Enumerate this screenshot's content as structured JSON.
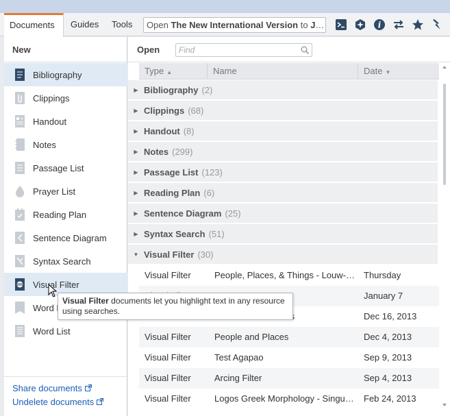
{
  "toolbar": {
    "tabs": [
      "Documents",
      "Guides",
      "Tools"
    ],
    "omnibox_prefix": "Open",
    "omnibox_bold1": "The New International Version",
    "omnibox_mid": "to",
    "omnibox_bold2": "John…",
    "icons": [
      "console-icon",
      "compass-icon",
      "info-icon",
      "swap-icon",
      "star-icon",
      "lightning-icon"
    ]
  },
  "left": {
    "header": "New",
    "items": [
      {
        "label": "Bibliography",
        "icon": "bibliography-icon",
        "selected": true
      },
      {
        "label": "Clippings",
        "icon": "paperclip-icon"
      },
      {
        "label": "Handout",
        "icon": "handout-icon"
      },
      {
        "label": "Notes",
        "icon": "notes-icon"
      },
      {
        "label": "Passage List",
        "icon": "passage-list-icon"
      },
      {
        "label": "Prayer List",
        "icon": "prayer-list-icon"
      },
      {
        "label": "Reading Plan",
        "icon": "calendar-icon"
      },
      {
        "label": "Sentence Diagram",
        "icon": "sentence-diagram-icon"
      },
      {
        "label": "Syntax Search",
        "icon": "syntax-search-icon"
      },
      {
        "label": "Visual Filter",
        "icon": "visual-filter-icon"
      },
      {
        "label": "Word F",
        "icon": "word-find-icon"
      },
      {
        "label": "Word List",
        "icon": "word-list-icon"
      }
    ],
    "links": [
      "Share documents",
      "Undelete documents"
    ]
  },
  "right": {
    "header": "Open",
    "find_placeholder": "Find",
    "columns": [
      "Type",
      "Name",
      "Date"
    ],
    "groups": [
      {
        "name": "Bibliography",
        "count": "(2)"
      },
      {
        "name": "Clippings",
        "count": "(68)"
      },
      {
        "name": "Handout",
        "count": "(8)"
      },
      {
        "name": "Notes",
        "count": "(299)"
      },
      {
        "name": "Passage List",
        "count": "(123)"
      },
      {
        "name": "Reading Plan",
        "count": "(6)"
      },
      {
        "name": "Sentence Diagram",
        "count": "(25)"
      },
      {
        "name": "Syntax Search",
        "count": "(51)"
      },
      {
        "name": "Visual Filter",
        "count": "(30)",
        "expanded": true
      }
    ],
    "rows": [
      {
        "type": "Visual Filter",
        "name": "People, Places, & Things - Louw-Nida",
        "date": "Thursday"
      },
      {
        "type": "Visual Filter",
        "name": "",
        "date": "January 7"
      },
      {
        "type": "Visual Filter",
        "name": "Pentateuch Sources",
        "date": "Dec 16, 2013"
      },
      {
        "type": "Visual Filter",
        "name": "People and Places",
        "date": "Dec 4, 2013"
      },
      {
        "type": "Visual Filter",
        "name": "Test Agapao",
        "date": "Sep 9, 2013"
      },
      {
        "type": "Visual Filter",
        "name": "Arcing Filter",
        "date": "Sep 4, 2013"
      },
      {
        "type": "Visual Filter",
        "name": "Logos Greek Morphology - Singula…",
        "date": "Feb 24, 2013"
      }
    ]
  },
  "tooltip": {
    "bold": "Visual Filter",
    "text": "documents let you highlight text in any resource using searches."
  },
  "colors": {
    "accent_tab": "#e07a37",
    "link": "#1a5fb4",
    "selection": "#dfeaf5",
    "icon": "#2f4a66"
  }
}
